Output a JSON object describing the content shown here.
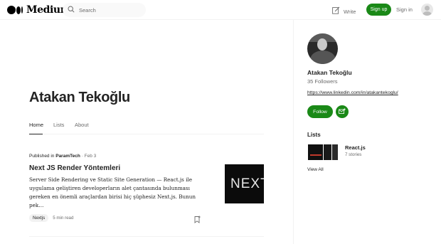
{
  "header": {
    "logo_text": "Medium",
    "search_placeholder": "Search",
    "write_label": "Write",
    "signup_label": "Sign up",
    "signin_label": "Sign in"
  },
  "profile": {
    "name": "Atakan Tekoğlu"
  },
  "tabs": [
    {
      "label": "Home",
      "active": true
    },
    {
      "label": "Lists",
      "active": false
    },
    {
      "label": "About",
      "active": false
    }
  ],
  "article": {
    "published_prefix": "Published in",
    "publication": "ParamTech",
    "separator": "·",
    "date": "Feb 3",
    "title": "Next JS Render Yöntemleri",
    "excerpt": "Server Side Rendering ve Static Site Generation — React.js ile uygulama geliştiren developerların alet çantasında bulunması gereken en önemli araçlardan birisi hiç şüphesiz Next.js. Bunun pek…",
    "thumbnail_text": "NEXT.",
    "tag": "Nextjs",
    "read_time": "5 min read"
  },
  "sidebar": {
    "name": "Atakan Tekoğlu",
    "followers": "35 Followers",
    "link": "https://www.linkedin.com/in/atakantekoglu/",
    "follow_label": "Follow",
    "lists_heading": "Lists",
    "list": {
      "title": "React.js",
      "count": "7 stories"
    },
    "view_all_label": "View All"
  },
  "colors": {
    "accent_green": "#1a8917",
    "text_primary": "#242424",
    "text_muted": "#6b6b6b"
  }
}
